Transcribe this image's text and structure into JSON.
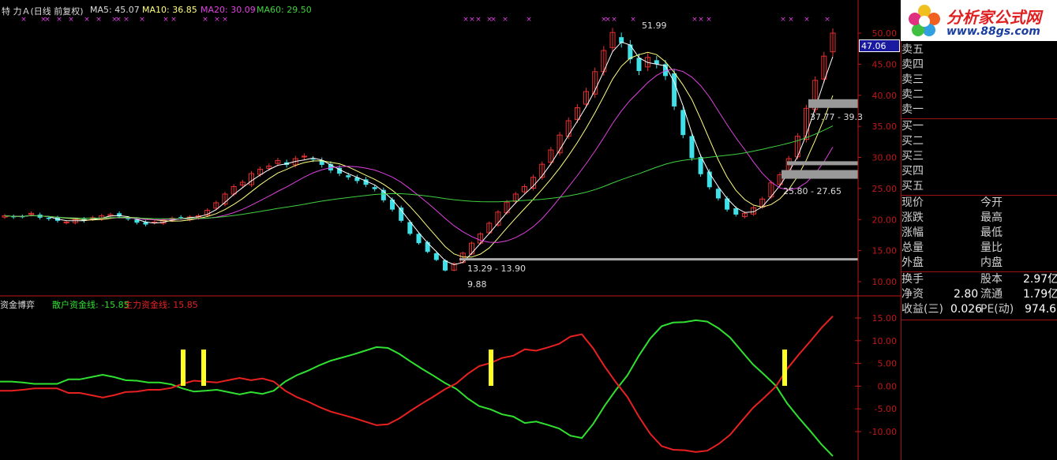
{
  "header": {
    "title": "特  力Ａ(日线 前复权)",
    "ma5": "MA5: 45.07",
    "ma10": "MA10: 36.85",
    "ma20": "MA20: 30.09",
    "ma60": "MA60: 29.50"
  },
  "price_panel": {
    "current_tag": "47.06",
    "annot_high": "51.99",
    "annot_low": "9.88",
    "annot_range_low": "13.29 - 13.90",
    "annot_range_mid": "25.80 - 27.65",
    "annot_range_high": "37.77 - 39.3"
  },
  "indicator_header": {
    "name": "资金博弈",
    "retail": "散户资金线: -15.85",
    "main": "主力资金线: 15.85"
  },
  "colors": {
    "up": "#e83030",
    "down": "#40e0e8",
    "ma5": "#ffffff",
    "ma10": "#ffff80",
    "ma20": "#e040e0",
    "ma60": "#40d040",
    "retail_line": "#30e030",
    "main_line": "#e82020",
    "signal": "#ffff20",
    "axis": "#c01818"
  },
  "chart_data": [
    {
      "type": "candlestick",
      "title": "特  力Ａ(日线 前复权)",
      "ylim": [
        10,
        50
      ],
      "ytick_labels": [
        "50.00",
        "45.00",
        "40.00",
        "35.00",
        "30.00",
        "25.00",
        "20.00",
        "15.00",
        "10.00"
      ],
      "high_marker": 51.99,
      "low_marker": 9.88,
      "close_series": [
        20.6,
        20.4,
        20.5,
        21.0,
        20.3,
        20.1,
        19.8,
        19.6,
        20.0,
        19.8,
        20.3,
        20.6,
        20.8,
        20.5,
        20.1,
        19.5,
        19.2,
        19.6,
        19.9,
        20.2,
        20.3,
        20.4,
        20.6,
        21.5,
        22.7,
        24.1,
        25.3,
        26.0,
        27.4,
        28.1,
        28.6,
        29.5,
        28.8,
        29.8,
        30.2,
        29.7,
        28.8,
        27.9,
        27.4,
        26.8,
        26.2,
        25.6,
        24.9,
        23.1,
        21.6,
        19.8,
        17.7,
        16.2,
        14.8,
        13.5,
        11.8,
        12.9,
        14.6,
        16.2,
        17.7,
        19.4,
        21.2,
        22.8,
        24.1,
        25.3,
        26.8,
        28.9,
        31.2,
        33.6,
        35.9,
        38.0,
        40.6,
        43.8,
        47.2,
        50.1,
        48.4,
        45.8,
        43.9,
        46.1,
        45.0,
        43.1,
        38.2,
        33.6,
        29.9,
        27.3,
        25.2,
        23.4,
        21.6,
        20.8,
        21.0,
        21.9,
        23.3,
        25.9,
        27.2,
        29.8,
        33.4,
        37.9,
        42.4,
        46.3,
        50.0
      ]
    },
    {
      "type": "line",
      "title": "资金博弈",
      "ylim": [
        -16,
        16
      ],
      "ytick_labels": [
        "15.00",
        "10.00",
        "5.00",
        "0.00",
        "-5.00",
        "-10.00"
      ],
      "series": [
        {
          "name": "散户资金线",
          "values": [
            1.0,
            1.0,
            0.8,
            0.5,
            0.5,
            0.5,
            1.5,
            1.5,
            2.0,
            2.5,
            2.0,
            1.3,
            1.2,
            0.8,
            0.8,
            0.4,
            -0.5,
            -1.2,
            -1.0,
            -0.8,
            -1.3,
            -1.8,
            -1.3,
            -1.7,
            -1.0,
            1.0,
            2.4,
            3.4,
            4.6,
            5.6,
            6.3,
            7.0,
            7.8,
            8.6,
            8.4,
            7.1,
            5.4,
            3.8,
            2.3,
            0.7,
            -0.6,
            -2.7,
            -4.4,
            -5.1,
            -6.2,
            -6.7,
            -8.1,
            -7.8,
            -8.5,
            -9.3,
            -10.9,
            -11.4,
            -8.3,
            -4.3,
            -0.8,
            2.4,
            6.7,
            10.5,
            13.2,
            14.0,
            14.1,
            14.5,
            14.2,
            12.7,
            10.7,
            7.7,
            4.8,
            2.5,
            0.1,
            -3.8,
            -6.9,
            -9.8,
            -12.8,
            -15.4
          ]
        },
        {
          "name": "主力资金线",
          "values": [
            -1.0,
            -1.0,
            -0.8,
            -0.5,
            -0.5,
            -0.5,
            -1.5,
            -1.5,
            -2.0,
            -2.5,
            -2.0,
            -1.3,
            -1.2,
            -0.8,
            -0.8,
            -0.4,
            0.5,
            1.2,
            1.0,
            0.8,
            1.3,
            1.8,
            1.3,
            1.7,
            1.0,
            -1.0,
            -2.4,
            -3.4,
            -4.6,
            -5.6,
            -6.3,
            -7.0,
            -7.8,
            -8.6,
            -8.4,
            -7.1,
            -5.4,
            -3.8,
            -2.3,
            -0.7,
            0.6,
            2.7,
            4.4,
            5.1,
            6.2,
            6.7,
            8.1,
            7.8,
            8.5,
            9.3,
            10.9,
            11.4,
            8.3,
            4.3,
            0.8,
            -2.4,
            -6.7,
            -10.5,
            -13.2,
            -14.0,
            -14.1,
            -14.5,
            -14.2,
            -12.7,
            -10.7,
            -7.7,
            -4.8,
            -2.5,
            -0.1,
            3.8,
            6.9,
            9.8,
            12.8,
            15.4
          ]
        }
      ]
    }
  ],
  "quote_panel": {
    "logo_top": "分析家公式网",
    "logo_bottom": "www.88gs.com",
    "sell": [
      "卖五",
      "卖四",
      "卖三",
      "卖二",
      "卖一"
    ],
    "buy": [
      "买一",
      "买二",
      "买三",
      "买四",
      "买五"
    ],
    "left_col": [
      "现价",
      "涨跌",
      "涨幅",
      "总量",
      "外盘"
    ],
    "right_col": [
      "今开",
      "最高",
      "最低",
      "量比",
      "内盘"
    ],
    "stats": [
      {
        "l1": "换手",
        "v1": "",
        "l2": "股本",
        "v2": "2.97亿"
      },
      {
        "l1": "净资",
        "v1": "2.80",
        "l2": "流通",
        "v2": "1.79亿"
      },
      {
        "l1": "收益(三)",
        "v1": "0.026",
        "l2": "PE(动)",
        "v2": "974.6"
      }
    ]
  }
}
